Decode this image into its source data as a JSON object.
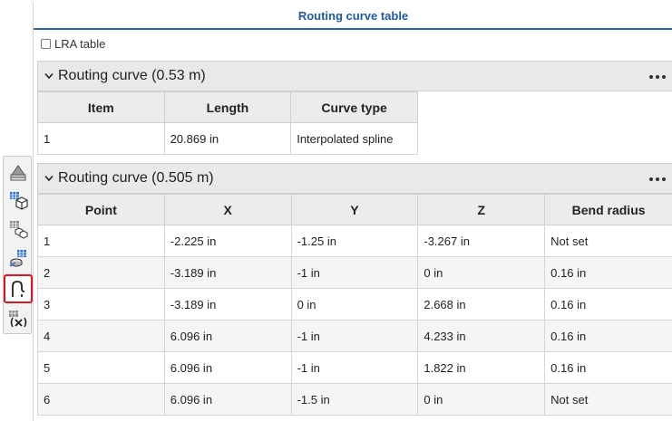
{
  "panel": {
    "title": "Routing curve table",
    "lra_label": "LRA table"
  },
  "toolbar": {
    "tools": [
      {
        "icon": "layers-stack-icon"
      },
      {
        "icon": "cube-table-icon"
      },
      {
        "icon": "multi-cube-table-icon"
      },
      {
        "icon": "part-table-icon"
      },
      {
        "icon": "routing-curve-icon",
        "selected": true
      },
      {
        "icon": "variable-table-icon"
      }
    ]
  },
  "section1": {
    "title": "Routing curve (0.53 m)",
    "headers": [
      "Item",
      "Length",
      "Curve type"
    ],
    "rows": [
      [
        "1",
        "20.869 in",
        "Interpolated spline"
      ]
    ]
  },
  "section2": {
    "title": "Routing curve (0.505 m)",
    "headers": [
      "Point",
      "X",
      "Y",
      "Z",
      "Bend radius"
    ],
    "rows": [
      [
        "1",
        "-2.225 in",
        "-1.25 in",
        "-3.267 in",
        "Not set"
      ],
      [
        "2",
        "-3.189 in",
        "-1 in",
        "0 in",
        "0.16 in"
      ],
      [
        "3",
        "-3.189 in",
        "0 in",
        "2.668 in",
        "0.16 in"
      ],
      [
        "4",
        "6.096 in",
        "-1 in",
        "4.233 in",
        "0.16 in"
      ],
      [
        "5",
        "6.096 in",
        "-1 in",
        "1.822 in",
        "0.16 in"
      ],
      [
        "6",
        "6.096 in",
        "-1.5 in",
        "0 in",
        "Not set"
      ]
    ]
  }
}
